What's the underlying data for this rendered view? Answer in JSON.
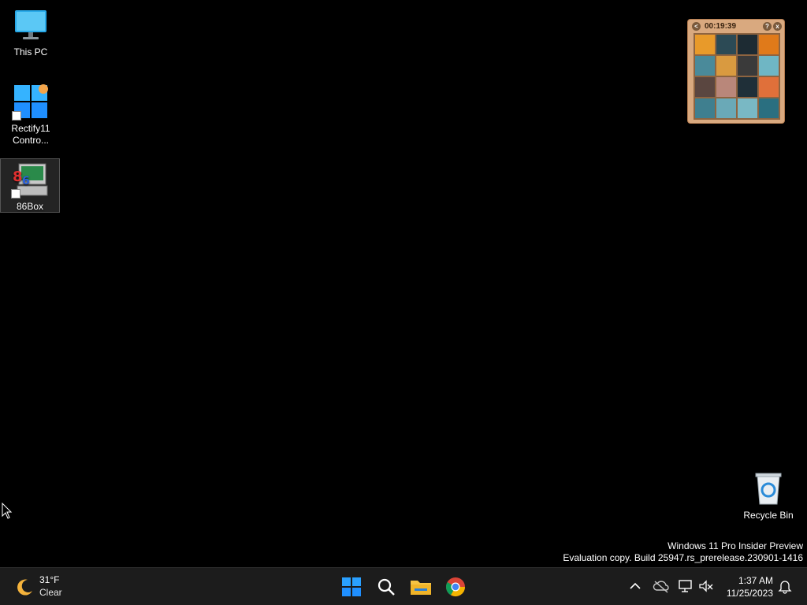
{
  "desktop": {
    "icons": [
      {
        "label": "This PC"
      },
      {
        "label": "Rectify11\nContro..."
      },
      {
        "label": "86Box"
      },
      {
        "label": "Recycle Bin"
      }
    ]
  },
  "gadget": {
    "timer": "00:19:39",
    "buttons": {
      "left": "<",
      "help": "?",
      "close": "x"
    },
    "tiles": [
      "#e89a2a",
      "#2c4a55",
      "#1d2b33",
      "#e07a1a",
      "#4a8a9a",
      "#d99a40",
      "#3a3a3a",
      "#6fb6c4",
      "#5a4640",
      "#b9877a",
      "#1f2f38",
      "#e0703a",
      "#3f7f8f",
      "#6aa9b7",
      "#79b8c4",
      "#2a6f80"
    ]
  },
  "watermark": {
    "line1": "Windows 11 Pro Insider Preview",
    "line2": "Evaluation copy. Build 25947.rs_prerelease.230901-1416"
  },
  "taskbar": {
    "weather": {
      "temp": "31°F",
      "condition": "Clear"
    },
    "apps": [
      "start-icon",
      "search-icon",
      "file-explorer-icon",
      "chrome-icon"
    ],
    "clock": {
      "time": "1:37 AM",
      "date": "11/25/2023"
    }
  },
  "colors": {
    "taskbar": "#1c1c1c",
    "start_blue": "#1f8fff",
    "gadget_frame": "#d9a97f"
  }
}
